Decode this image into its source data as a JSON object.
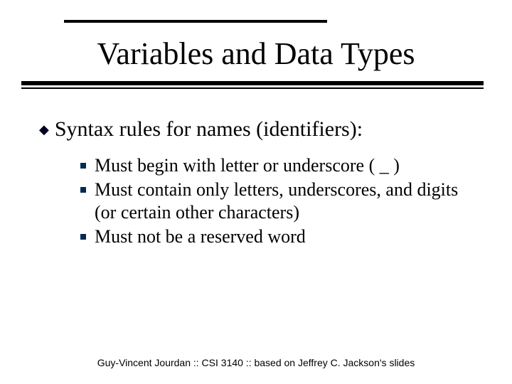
{
  "title": "Variables and Data Types",
  "l1": {
    "bullet": "◆",
    "text": "Syntax rules for names (identifiers):"
  },
  "l2": [
    "Must begin with letter or underscore ( _ )",
    "Must contain only letters, underscores, and digits (or certain other characters)",
    "Must not be a reserved word"
  ],
  "footer": "Guy-Vincent Jourdan :: CSI 3140 :: based on Jeffrey C. Jackson's slides"
}
